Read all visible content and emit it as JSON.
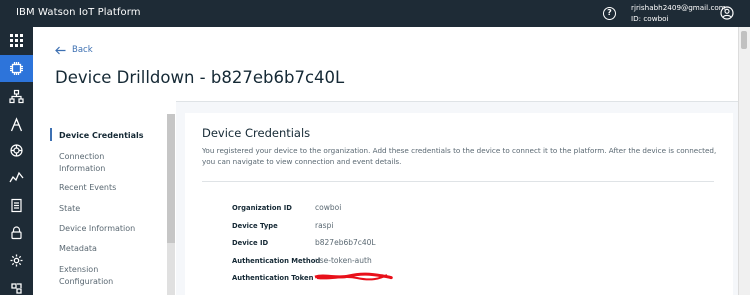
{
  "topbar": {
    "brand": "IBM Watson IoT Platform",
    "help": "?",
    "user_email": "rjrishabh2409@gmail.com",
    "user_id": "ID: cowboi"
  },
  "rail": {
    "icons": [
      "apps-grid-icon",
      "devices-chip-icon",
      "members-icon",
      "rules-icon",
      "security-shield-icon",
      "analytics-icon",
      "usage-doc-icon",
      "lock-icon",
      "settings-gear-icon",
      "extensions-icon"
    ],
    "active_index": 1
  },
  "header": {
    "back_label": "Back",
    "title": "Device Drilldown - b827eb6b7c40L"
  },
  "nav": {
    "items": [
      {
        "label": "Device Credentials",
        "active": true
      },
      {
        "label": "Connection Information",
        "active": false
      },
      {
        "label": "Recent Events",
        "active": false
      },
      {
        "label": "State",
        "active": false
      },
      {
        "label": "Device Information",
        "active": false
      },
      {
        "label": "Metadata",
        "active": false
      },
      {
        "label": "Extension Configuration",
        "active": false
      }
    ]
  },
  "content": {
    "title": "Device Credentials",
    "description": "You registered your device to the organization. Add these credentials to the device to connect it to the platform. After the device is connected, you can navigate to view connection and event details.",
    "fields": [
      {
        "label": "Organization ID",
        "value": "cowboi"
      },
      {
        "label": "Device Type",
        "value": "raspi"
      },
      {
        "label": "Device ID",
        "value": "b827eb6b7c40L"
      },
      {
        "label": "Authentication Method",
        "value": "use-token-auth"
      },
      {
        "label": "Authentication Token",
        "value": ""
      }
    ]
  },
  "colors": {
    "topbar": "#1e2b36",
    "accent": "#2d74da",
    "link": "#3d70b2",
    "redaction": "#e8101a"
  }
}
